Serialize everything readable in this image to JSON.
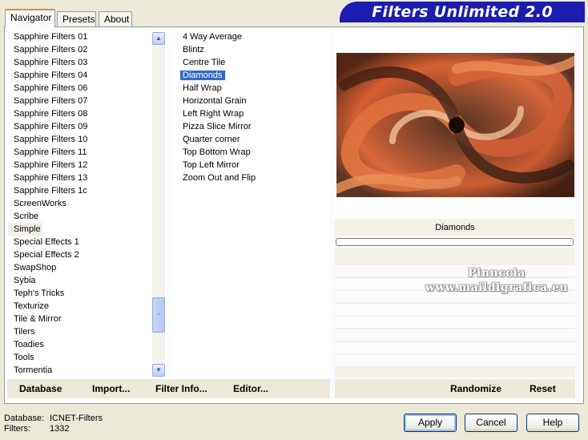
{
  "tabs": [
    {
      "label": "Navigator",
      "active": true
    },
    {
      "label": "Presets",
      "active": false
    },
    {
      "label": "About",
      "active": false
    }
  ],
  "app_title": "Filters Unlimited 2.0",
  "categories": [
    "Sapphire Filters 01",
    "Sapphire Filters 02",
    "Sapphire Filters 03",
    "Sapphire Filters 04",
    "Sapphire Filters 06",
    "Sapphire Filters 07",
    "Sapphire Filters 08",
    "Sapphire Filters 09",
    "Sapphire Filters 10",
    "Sapphire Filters 11",
    "Sapphire Filters 12",
    "Sapphire Filters 13",
    "Sapphire Filters 1c",
    "ScreenWorks",
    "Scribe",
    "Simple",
    "Special Effects 1",
    "Special Effects 2",
    "SwapShop",
    "Sybia",
    "Teph's Tricks",
    "Texturize",
    "Tile & Mirror",
    "Tilers",
    "Toadies",
    "Tools",
    "Tormentia"
  ],
  "highlighted_category": "Simple",
  "filters": [
    "4 Way Average",
    "Blintz",
    "Centre Tile",
    "Diamonds",
    "Half Wrap",
    "Horizontal Grain",
    "Left Right Wrap",
    "Pizza Slice Mirror",
    "Quarter corner",
    "Top Bottom Wrap",
    "Top Left Mirror",
    "Zoom Out and Flip"
  ],
  "selected_filter": "Diamonds",
  "preview": {
    "filter_name": "Diamonds"
  },
  "watermark": {
    "line1": "Pinuccia",
    "line2": "www.maildigrafica.eu"
  },
  "toolbar": {
    "database": "Database",
    "import": "Import...",
    "filter_info": "Filter Info...",
    "editor": "Editor...",
    "randomize": "Randomize",
    "reset": "Reset"
  },
  "status": {
    "database_label": "Database:",
    "database_value": "ICNET-Filters",
    "filters_label": "Filters:",
    "filters_value": "1332"
  },
  "buttons": {
    "apply": "Apply",
    "cancel": "Cancel",
    "help": "Help"
  },
  "colors": {
    "banner": "#1c1cae",
    "selection": "#316ac5",
    "tab_accent": "#e68b2c"
  }
}
